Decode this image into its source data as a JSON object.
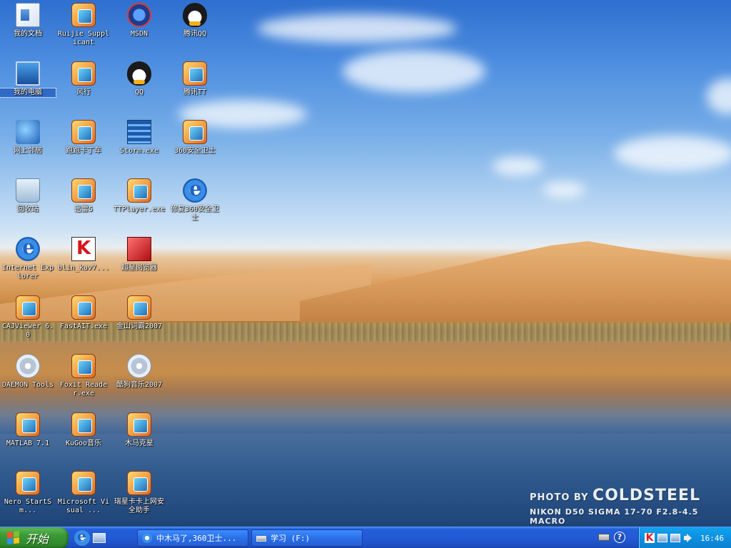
{
  "desktop": {
    "icons": [
      {
        "label": "我的文档",
        "icon": "my-documents-icon"
      },
      {
        "label": "Ruijie Supplicant",
        "icon": "ruijie-supplicant-icon"
      },
      {
        "label": "MSDN",
        "icon": "msdn-icon"
      },
      {
        "label": "腾讯QQ",
        "icon": "tencent-qq-icon"
      },
      {
        "label": "我的电脑",
        "icon": "my-computer-icon"
      },
      {
        "label": "风行",
        "icon": "funshion-icon"
      },
      {
        "label": "QQ",
        "icon": "qq-icon"
      },
      {
        "label": "腾讯TT",
        "icon": "tencent-tt-icon"
      },
      {
        "label": "网上邻居",
        "icon": "network-places-icon"
      },
      {
        "label": "跑跑卡丁车",
        "icon": "kartrider-icon"
      },
      {
        "label": "Storm.exe",
        "icon": "storm-player-icon"
      },
      {
        "label": "360安全卫士",
        "icon": "360-safe-icon"
      },
      {
        "label": "回收站",
        "icon": "recycle-bin-icon"
      },
      {
        "label": "迅雷5",
        "icon": "thunder-icon"
      },
      {
        "label": "TTPlayer.exe",
        "icon": "ttplayer-icon"
      },
      {
        "label": "修复360安全卫士",
        "icon": "repair-360-icon"
      },
      {
        "label": "Internet Explorer",
        "icon": "internet-explorer-icon"
      },
      {
        "label": "blin_kav7...",
        "icon": "kaspersky-icon"
      },
      {
        "label": "超星阅览器",
        "icon": "ssreader-icon"
      },
      {
        "label": "CAJViewer 6.0",
        "icon": "cajviewer-icon"
      },
      {
        "label": "FastAIT.exe",
        "icon": "fastait-icon"
      },
      {
        "label": "金山词霸2007",
        "icon": "kingsoft-powerword-icon"
      },
      {
        "label": "DAEMON Tools",
        "icon": "daemon-tools-icon"
      },
      {
        "label": "Foxit Reader.exe",
        "icon": "foxit-reader-icon"
      },
      {
        "label": "酷狗音乐2007",
        "icon": "kugou-2007-icon"
      },
      {
        "label": "MATLAB 7.1",
        "icon": "matlab-icon"
      },
      {
        "label": "KuGoo音乐",
        "icon": "kugoo-icon"
      },
      {
        "label": "木马克星",
        "icon": "trojan-killer-icon"
      },
      {
        "label": "Nero StartSm...",
        "icon": "nero-icon"
      },
      {
        "label": "Microsoft Visual ...",
        "icon": "visual-studio-icon"
      },
      {
        "label": "瑞星卡卡上网安全助手",
        "icon": "rising-kaka-icon"
      }
    ]
  },
  "watermark": {
    "photo_by": "PHOTO BY",
    "author": "COLDSTEEL",
    "camera": "NIKON D50   SIGMA 17-70 F2.8-4.5 MACRO"
  },
  "taskbar": {
    "start_label": "开始",
    "quick_launch": [
      {
        "icon": "ie-quicklaunch-icon"
      },
      {
        "icon": "show-desktop-icon"
      }
    ],
    "tasks": [
      {
        "label": "中木马了,360卫士...",
        "icon": "ie-window-icon"
      },
      {
        "label": "学习 (F:)",
        "icon": "drive-window-icon"
      }
    ],
    "tray": {
      "clock": "16:46"
    }
  },
  "colors": {
    "taskbar_blue": "#245edb",
    "start_green": "#3c9b36",
    "tray_blue": "#0d8fe0"
  }
}
